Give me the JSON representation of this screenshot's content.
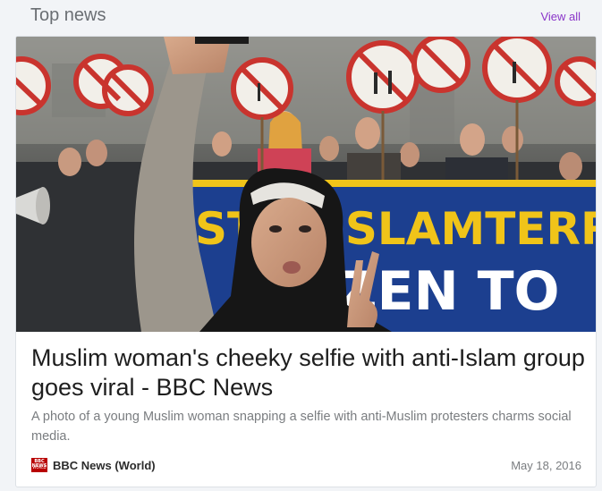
{
  "section": {
    "title": "Top news",
    "view_all_label": "View all"
  },
  "article": {
    "headline": "Muslim woman's cheeky selfie with anti-Islam group goes viral - BBC News",
    "snippet": "A photo of a young Muslim woman snapping a selfie with anti-Muslim protesters charms social media.",
    "source_name": "BBC News (World)",
    "source_logo_text": "BBC NEWS",
    "source_logo_subtext": "WORLD",
    "date": "May 18, 2016",
    "image": {
      "banner_text_line1": "STOPISLAMTERRI",
      "banner_text_line2": "ZEN TO",
      "icon": "news-photo-image"
    }
  },
  "colors": {
    "accent": "#8a35c9",
    "bbc_red": "#b80000",
    "banner_blue": "#1c3f8f",
    "banner_yellow": "#f0c419",
    "sign_red": "#d01f26"
  }
}
